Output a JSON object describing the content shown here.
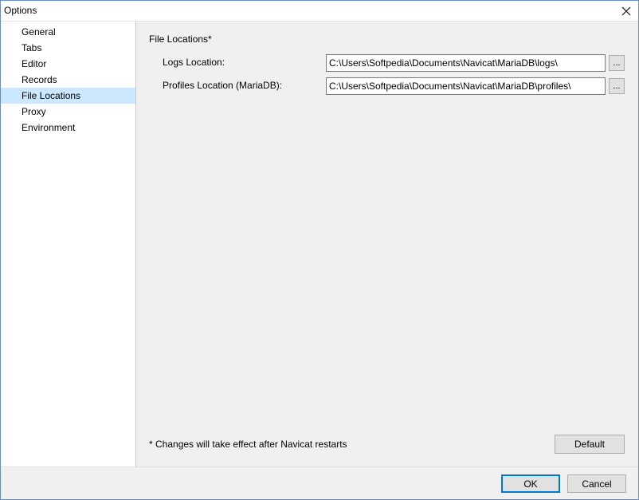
{
  "window": {
    "title": "Options"
  },
  "sidebar": {
    "items": [
      {
        "label": "General"
      },
      {
        "label": "Tabs"
      },
      {
        "label": "Editor"
      },
      {
        "label": "Records"
      },
      {
        "label": "File Locations"
      },
      {
        "label": "Proxy"
      },
      {
        "label": "Environment"
      }
    ],
    "selected": "File Locations"
  },
  "content": {
    "section_title": "File Locations*",
    "logs": {
      "label": "Logs Location:",
      "value": "C:\\Users\\Softpedia\\Documents\\Navicat\\MariaDB\\logs\\",
      "browse_label": "..."
    },
    "profiles": {
      "label": "Profiles Location (MariaDB):",
      "value": "C:\\Users\\Softpedia\\Documents\\Navicat\\MariaDB\\profiles\\",
      "browse_label": "..."
    },
    "note": "* Changes will take effect after Navicat restarts",
    "default_label": "Default"
  },
  "footer": {
    "ok_label": "OK",
    "cancel_label": "Cancel"
  },
  "icons": {
    "close": "close-icon"
  },
  "colors": {
    "selection": "#cce8ff",
    "focus_border": "#0078d7"
  }
}
